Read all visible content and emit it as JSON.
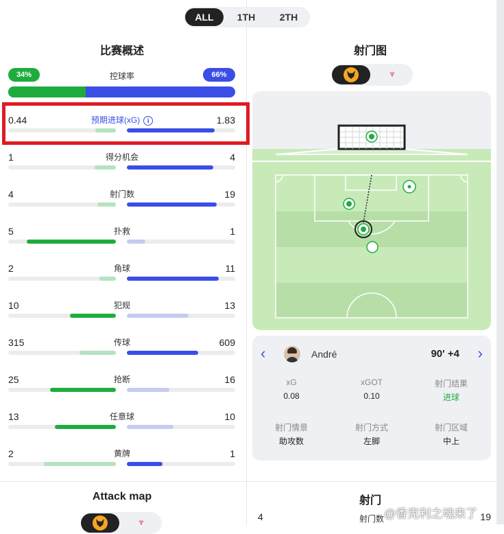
{
  "period_tabs": [
    "ALL",
    "1TH",
    "2TH"
  ],
  "active_period": "ALL",
  "overview": {
    "title": "比赛概述",
    "possession": {
      "label": "控球率",
      "home": "34%",
      "away": "66%",
      "home_fraction": 0.34
    },
    "stats": [
      {
        "label": "预期进球(xG)",
        "home": "0.44",
        "away": "1.83",
        "home_frac": 0.19,
        "away_frac": 0.81,
        "home_style": "green-light",
        "away_style": "blue-strong",
        "info": true,
        "highlighted": true
      },
      {
        "label": "得分机会",
        "home": "1",
        "away": "4",
        "home_frac": 0.2,
        "away_frac": 0.8,
        "home_style": "green-light",
        "away_style": "blue-strong"
      },
      {
        "label": "射门数",
        "home": "4",
        "away": "19",
        "home_frac": 0.17,
        "away_frac": 0.83,
        "home_style": "green-light",
        "away_style": "blue-strong"
      },
      {
        "label": "扑救",
        "home": "5",
        "away": "1",
        "home_frac": 0.83,
        "away_frac": 0.17,
        "home_style": "green-strong",
        "away_style": "blue-light"
      },
      {
        "label": "角球",
        "home": "2",
        "away": "11",
        "home_frac": 0.15,
        "away_frac": 0.85,
        "home_style": "green-light",
        "away_style": "blue-strong"
      },
      {
        "label": "犯规",
        "home": "10",
        "away": "13",
        "home_frac": 0.43,
        "away_frac": 0.57,
        "home_style": "green-strong",
        "away_style": "blue-light"
      },
      {
        "label": "传球",
        "home": "315",
        "away": "609",
        "home_frac": 0.34,
        "away_frac": 0.66,
        "home_style": "green-light",
        "away_style": "blue-strong"
      },
      {
        "label": "抢断",
        "home": "25",
        "away": "16",
        "home_frac": 0.61,
        "away_frac": 0.39,
        "home_style": "green-strong",
        "away_style": "blue-light"
      },
      {
        "label": "任意球",
        "home": "13",
        "away": "10",
        "home_frac": 0.57,
        "away_frac": 0.43,
        "home_style": "green-strong",
        "away_style": "blue-light"
      },
      {
        "label": "黄牌",
        "home": "2",
        "away": "1",
        "home_frac": 0.67,
        "away_frac": 0.33,
        "home_style": "green-light",
        "away_style": "blue-strong"
      }
    ]
  },
  "shotmap": {
    "title": "射门图",
    "teams": [
      {
        "icon": "wolves-badge-icon",
        "active": true
      },
      {
        "icon": "liverpool-badge-icon",
        "active": false
      }
    ],
    "selected_shot": {
      "player": "André",
      "time": "90' +4",
      "details": [
        {
          "label": "xG",
          "value": "0.08"
        },
        {
          "label": "xGOT",
          "value": "0.10"
        },
        {
          "label": "射门结果",
          "value": "进球",
          "is_goal": true
        },
        {
          "label": "射门情景",
          "value": "助攻数"
        },
        {
          "label": "射门方式",
          "value": "左脚"
        },
        {
          "label": "射门区域",
          "value": "中上"
        }
      ]
    }
  },
  "attack_map": {
    "title": "Attack map"
  },
  "shots_section": {
    "title": "射门",
    "home": "4",
    "label": "射门数",
    "away": "19"
  },
  "watermark": "@香克利之魂来了",
  "colors": {
    "home": "#1fac3f",
    "away": "#3a4ee6",
    "highlight": "#e01b24",
    "pitch": "#c8eab9"
  }
}
